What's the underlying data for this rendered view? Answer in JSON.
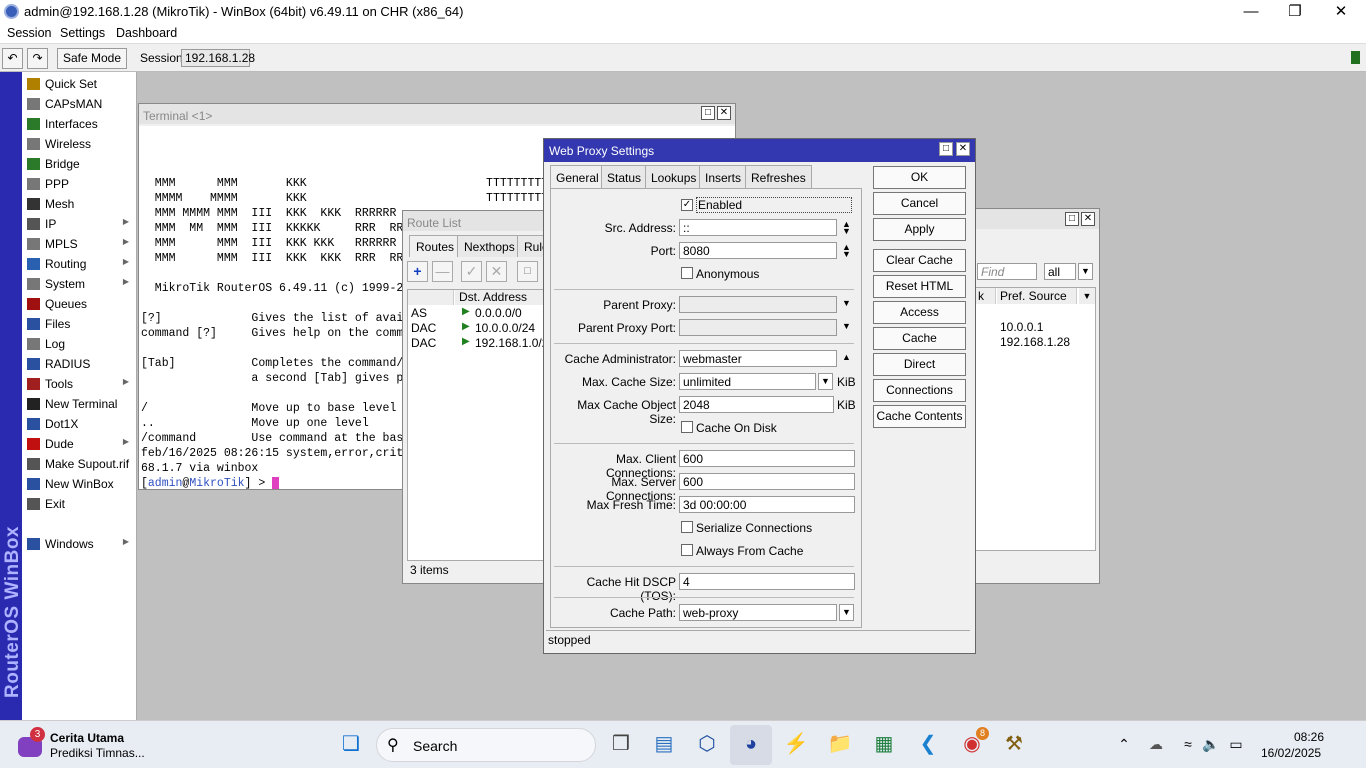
{
  "app": {
    "title": "admin@192.168.1.28 (MikroTik) - WinBox (64bit) v6.49.11 on CHR (x86_64)",
    "menu": [
      "Session",
      "Settings",
      "Dashboard"
    ],
    "safe_mode": "Safe Mode",
    "session_label": "Session:",
    "session_value": "192.168.1.28"
  },
  "sidebar": {
    "brand": "RouterOS WinBox",
    "items": [
      {
        "label": "Quick Set",
        "icon": "quick-set-icon",
        "color": "#b08000",
        "sub": false
      },
      {
        "label": "CAPsMAN",
        "icon": "capsman-icon",
        "color": "#777777",
        "sub": false
      },
      {
        "label": "Interfaces",
        "icon": "interfaces-icon",
        "color": "#2a7a2a",
        "sub": false
      },
      {
        "label": "Wireless",
        "icon": "wireless-icon",
        "color": "#777777",
        "sub": false
      },
      {
        "label": "Bridge",
        "icon": "bridge-icon",
        "color": "#2a7a2a",
        "sub": false
      },
      {
        "label": "PPP",
        "icon": "ppp-icon",
        "color": "#777777",
        "sub": false
      },
      {
        "label": "Mesh",
        "icon": "mesh-icon",
        "color": "#333333",
        "sub": false
      },
      {
        "label": "IP",
        "icon": "ip-icon",
        "color": "#555555",
        "sub": true
      },
      {
        "label": "MPLS",
        "icon": "mpls-icon",
        "color": "#777777",
        "sub": true
      },
      {
        "label": "Routing",
        "icon": "routing-icon",
        "color": "#2a60b0",
        "sub": true
      },
      {
        "label": "System",
        "icon": "system-icon",
        "color": "#777777",
        "sub": true
      },
      {
        "label": "Queues",
        "icon": "queues-icon",
        "color": "#a01010",
        "sub": false
      },
      {
        "label": "Files",
        "icon": "files-icon",
        "color": "#2a50a0",
        "sub": false
      },
      {
        "label": "Log",
        "icon": "log-icon",
        "color": "#777777",
        "sub": false
      },
      {
        "label": "RADIUS",
        "icon": "radius-icon",
        "color": "#2a50a0",
        "sub": false
      },
      {
        "label": "Tools",
        "icon": "tools-icon",
        "color": "#a02020",
        "sub": true
      },
      {
        "label": "New Terminal",
        "icon": "terminal-icon",
        "color": "#222222",
        "sub": false
      },
      {
        "label": "Dot1X",
        "icon": "dot1x-icon",
        "color": "#2a50a0",
        "sub": false
      },
      {
        "label": "Dude",
        "icon": "dude-icon",
        "color": "#c01010",
        "sub": true
      },
      {
        "label": "Make Supout.rif",
        "icon": "supout-icon",
        "color": "#555555",
        "sub": false
      },
      {
        "label": "New WinBox",
        "icon": "winbox-icon",
        "color": "#2a50a0",
        "sub": false
      },
      {
        "label": "Exit",
        "icon": "exit-icon",
        "color": "#555555",
        "sub": false
      },
      {
        "label": "Windows",
        "icon": "windows-icon",
        "color": "#2a50a0",
        "sub": true
      }
    ]
  },
  "terminal": {
    "title": "Terminal <1>",
    "lines": [
      "",
      "",
      "  MMM      MMM       KKK                          TTTTTTTTT",
      "  MMMM    MMMM       KKK                          TTTTTTTTT",
      "  MMM MMMM MMM  III  KKK  KKK  RRRRRR",
      "  MMM  MM  MMM  III  KKKKK     RRR  RR",
      "  MMM      MMM  III  KKK KKK   RRRRRR",
      "  MMM      MMM  III  KKK  KKK  RRR  RR",
      "",
      "  MikroTik RouterOS 6.49.11 (c) 1999-2",
      "",
      "[?]             Gives the list of avai",
      "command [?]     Gives help on the comm",
      "",
      "[Tab]           Completes the command/",
      "                a second [Tab] gives p",
      "",
      "/               Move up to base level",
      "..              Move up one level",
      "/command        Use command at the bas",
      "feb/16/2025 08:26:15 system,error,crit",
      "68.1.7 via winbox"
    ],
    "prompt_user": "admin",
    "prompt_host": "MikroTik",
    "prompt_pre": "[",
    "prompt_post": "] > "
  },
  "route_list": {
    "title": "Route List",
    "tabs": [
      "Routes",
      "Nexthops",
      "Rule"
    ],
    "column": "Dst. Address",
    "rows": [
      {
        "flags": "AS",
        "dst": "0.0.0.0/0"
      },
      {
        "flags": "DAC",
        "dst": "10.0.0.0/24"
      },
      {
        "flags": "DAC",
        "dst": "192.168.1.0/2"
      }
    ],
    "status": "3 items"
  },
  "bg_window": {
    "find_placeholder": "Find",
    "filter_value": "all",
    "col_partial": "k",
    "column": "Pref. Source",
    "rows": [
      "",
      "10.0.0.1",
      "192.168.1.28"
    ]
  },
  "web_proxy": {
    "title": "Web Proxy Settings",
    "tabs": [
      "General",
      "Status",
      "Lookups",
      "Inserts",
      "Refreshes"
    ],
    "enabled_label": "Enabled",
    "src_address_label": "Src. Address:",
    "src_address": "::",
    "port_label": "Port:",
    "port": "8080",
    "anonymous_label": "Anonymous",
    "parent_proxy_label": "Parent Proxy:",
    "parent_proxy_port_label": "Parent Proxy Port:",
    "cache_admin_label": "Cache Administrator:",
    "cache_admin": "webmaster",
    "max_cache_size_label": "Max. Cache Size:",
    "max_cache_size": "unlimited",
    "max_cache_size_unit": "KiB",
    "max_cache_object_label": "Max Cache Object Size:",
    "max_cache_object": "2048",
    "max_cache_object_unit": "KiB",
    "cache_on_disk_label": "Cache On Disk",
    "max_client_label": "Max. Client Connections:",
    "max_client": "600",
    "max_server_label": "Max. Server Connections:",
    "max_server": "600",
    "max_fresh_label": "Max Fresh Time:",
    "max_fresh": "3d 00:00:00",
    "serialize_label": "Serialize Connections",
    "always_from_cache_label": "Always From Cache",
    "dscp_label": "Cache Hit DSCP (TOS):",
    "dscp": "4",
    "cache_path_label": "Cache Path:",
    "cache_path": "web-proxy",
    "status": "stopped",
    "buttons": [
      "OK",
      "Cancel",
      "Apply",
      "Clear Cache",
      "Reset HTML",
      "Access",
      "Cache",
      "Direct",
      "Connections",
      "Cache Contents"
    ]
  },
  "taskbar": {
    "news_badge": "3",
    "news_title": "Cerita Utama",
    "news_sub": "Prediksi Timnas...",
    "search_label": "Search",
    "chrome_badge": "8",
    "time": "08:26",
    "date": "16/02/2025"
  }
}
